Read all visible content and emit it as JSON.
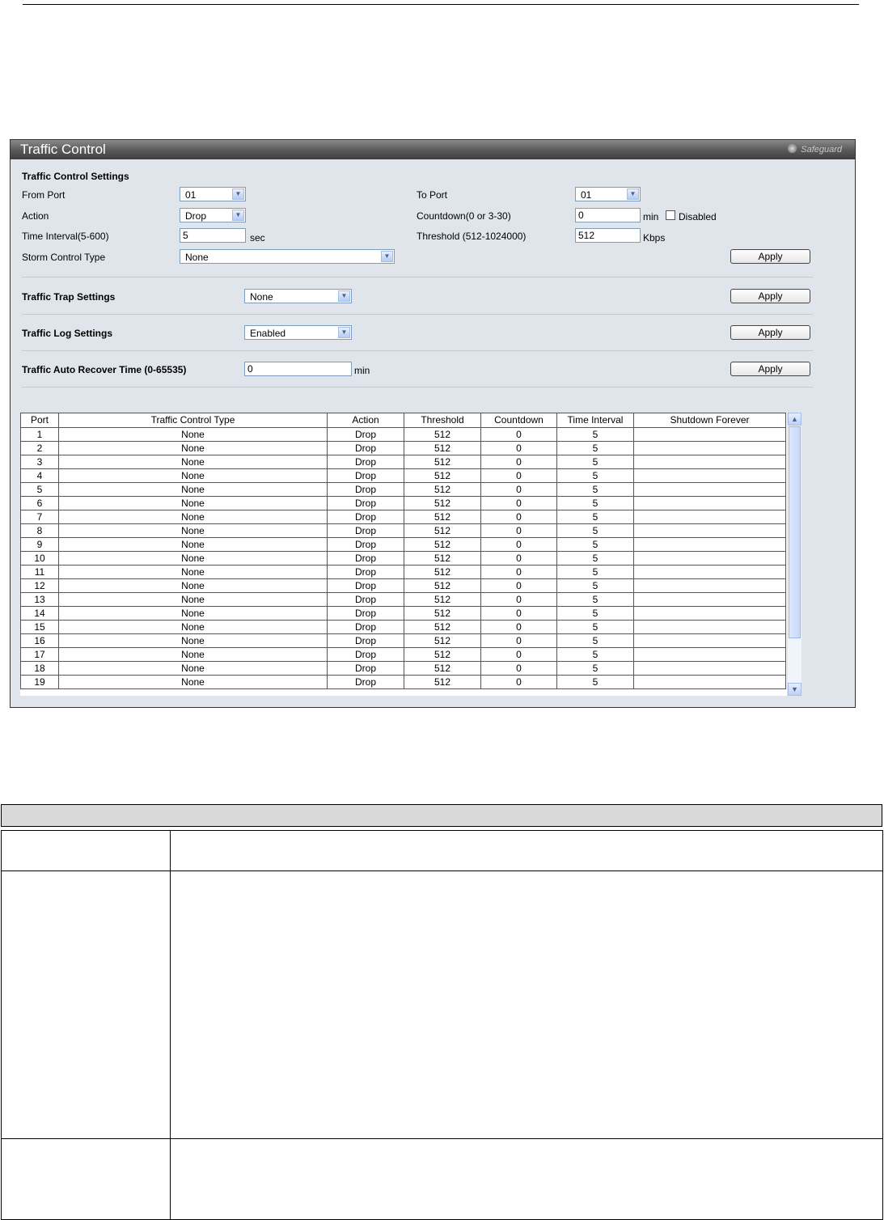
{
  "panel": {
    "title": "Traffic Control",
    "safeguard": "Safeguard"
  },
  "settings": {
    "section_title": "Traffic Control Settings",
    "from_port_label": "From Port",
    "from_port_value": "01",
    "to_port_label": "To Port",
    "to_port_value": "01",
    "action_label": "Action",
    "action_value": "Drop",
    "countdown_label": "Countdown(0 or 3-30)",
    "countdown_value": "0",
    "countdown_unit": "min",
    "disabled_label": "Disabled",
    "time_interval_label": "Time Interval(5-600)",
    "time_interval_value": "5",
    "time_interval_unit": "sec",
    "threshold_label": "Threshold (512-1024000)",
    "threshold_value": "512",
    "threshold_unit": "Kbps",
    "storm_type_label": "Storm Control Type",
    "storm_type_value": "None",
    "apply_label": "Apply"
  },
  "trap": {
    "label": "Traffic Trap Settings",
    "value": "None",
    "apply_label": "Apply"
  },
  "log": {
    "label": "Traffic Log Settings",
    "value": "Enabled",
    "apply_label": "Apply"
  },
  "recover": {
    "label": "Traffic Auto Recover Time (0-65535)",
    "value": "0",
    "unit": "min",
    "apply_label": "Apply"
  },
  "table": {
    "headers": [
      "Port",
      "Traffic Control Type",
      "Action",
      "Threshold",
      "Countdown",
      "Time Interval",
      "Shutdown Forever"
    ],
    "rows": [
      [
        "1",
        "None",
        "Drop",
        "512",
        "0",
        "5",
        ""
      ],
      [
        "2",
        "None",
        "Drop",
        "512",
        "0",
        "5",
        ""
      ],
      [
        "3",
        "None",
        "Drop",
        "512",
        "0",
        "5",
        ""
      ],
      [
        "4",
        "None",
        "Drop",
        "512",
        "0",
        "5",
        ""
      ],
      [
        "5",
        "None",
        "Drop",
        "512",
        "0",
        "5",
        ""
      ],
      [
        "6",
        "None",
        "Drop",
        "512",
        "0",
        "5",
        ""
      ],
      [
        "7",
        "None",
        "Drop",
        "512",
        "0",
        "5",
        ""
      ],
      [
        "8",
        "None",
        "Drop",
        "512",
        "0",
        "5",
        ""
      ],
      [
        "9",
        "None",
        "Drop",
        "512",
        "0",
        "5",
        ""
      ],
      [
        "10",
        "None",
        "Drop",
        "512",
        "0",
        "5",
        ""
      ],
      [
        "11",
        "None",
        "Drop",
        "512",
        "0",
        "5",
        ""
      ],
      [
        "12",
        "None",
        "Drop",
        "512",
        "0",
        "5",
        ""
      ],
      [
        "13",
        "None",
        "Drop",
        "512",
        "0",
        "5",
        ""
      ],
      [
        "14",
        "None",
        "Drop",
        "512",
        "0",
        "5",
        ""
      ],
      [
        "15",
        "None",
        "Drop",
        "512",
        "0",
        "5",
        ""
      ],
      [
        "16",
        "None",
        "Drop",
        "512",
        "0",
        "5",
        ""
      ],
      [
        "17",
        "None",
        "Drop",
        "512",
        "0",
        "5",
        ""
      ],
      [
        "18",
        "None",
        "Drop",
        "512",
        "0",
        "5",
        ""
      ],
      [
        "19",
        "None",
        "Drop",
        "512",
        "0",
        "5",
        ""
      ]
    ]
  },
  "colors": {
    "panel_bg": "#dfe5eb",
    "title_bar": "#5c5c5c",
    "select_border": "#7f9db9",
    "scroll_thumb": "#c6d8fa"
  },
  "icons": {
    "select_arrow": "chevron-down-icon",
    "scroll_up": "chevron-up-icon",
    "scroll_down": "chevron-down-icon",
    "safeguard": "safeguard-indicator-icon"
  }
}
